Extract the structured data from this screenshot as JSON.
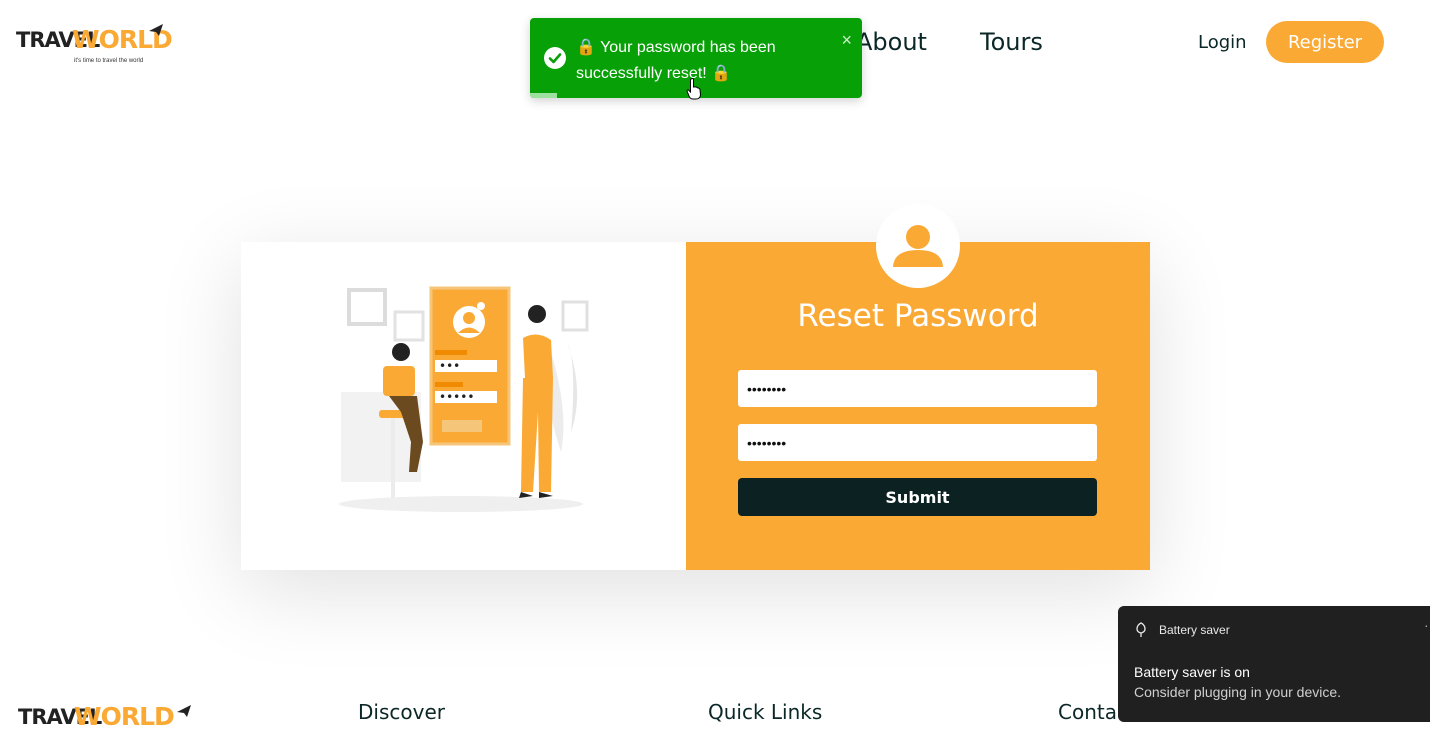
{
  "brand": {
    "name_part1": "TRAVEL",
    "name_part2": "WORLD",
    "tagline": "it's time to travel the world"
  },
  "nav": {
    "about": "About",
    "tours": "Tours"
  },
  "auth": {
    "login": "Login",
    "register": "Register"
  },
  "toast": {
    "message": "🔒 Your password has been successfully reset! 🔒",
    "close": "×",
    "progress_fraction": 0.08
  },
  "form": {
    "title": "Reset Password",
    "new_password_value": "••••••••",
    "confirm_password_value": "••••••••",
    "submit_label": "Submit"
  },
  "footer": {
    "discover": "Discover",
    "quick_links": "Quick Links",
    "contact": "Conta"
  },
  "notification": {
    "app": "Battery saver",
    "title": "Battery saver is on",
    "body": "Consider plugging in your device.",
    "more": "·"
  },
  "colors": {
    "accent": "#faa935",
    "dark": "#0b2122",
    "toast": "#07a007"
  }
}
